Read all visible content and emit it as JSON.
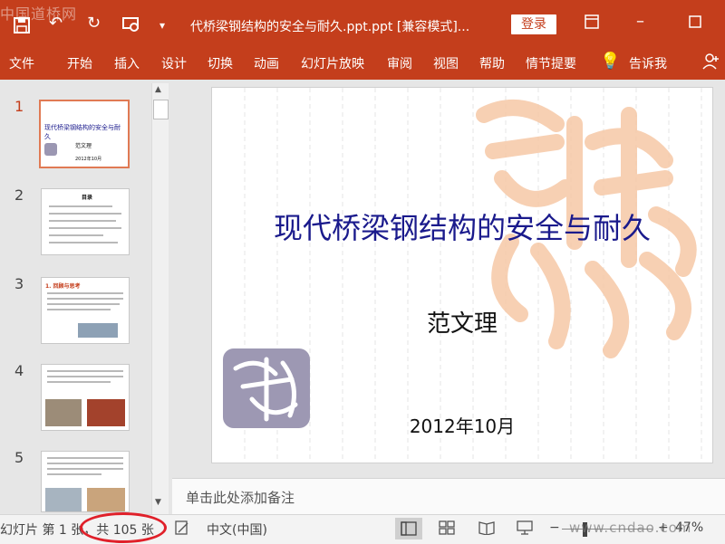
{
  "window": {
    "title": "代桥梁钢结构的安全与耐久.ppt.ppt [兼容模式]...",
    "login_label": "登录",
    "watermark_tl": "中国道桥网"
  },
  "ribbon": {
    "tabs": [
      "文件",
      "开始",
      "插入",
      "设计",
      "切换",
      "动画",
      "幻灯片放映",
      "审阅",
      "视图",
      "帮助",
      "情节提要",
      "告诉我"
    ]
  },
  "thumbnails": [
    {
      "number": "1",
      "selected": true,
      "title": "现代桥梁钢结构的安全与耐久",
      "author": "范文理",
      "date": "2012年10月"
    },
    {
      "number": "2",
      "selected": false,
      "title": "目录"
    },
    {
      "number": "3",
      "selected": false,
      "title": "1. 回顾与思考"
    },
    {
      "number": "4",
      "selected": false
    },
    {
      "number": "5",
      "selected": false
    }
  ],
  "slide": {
    "title": "现代桥梁钢结构的安全与耐久",
    "author": "范文理",
    "date": "2012年10月"
  },
  "notes": {
    "placeholder": "单击此处添加备注"
  },
  "status": {
    "slide_count": "幻灯片 第 1 张，共 105 张",
    "language": "中文(中国)",
    "zoom": "47%",
    "watermark": "www.cndao.com"
  },
  "colors": {
    "accent": "#c43e1c",
    "title_text": "#1a1a8c",
    "highlight_ellipse": "#e0202a"
  }
}
